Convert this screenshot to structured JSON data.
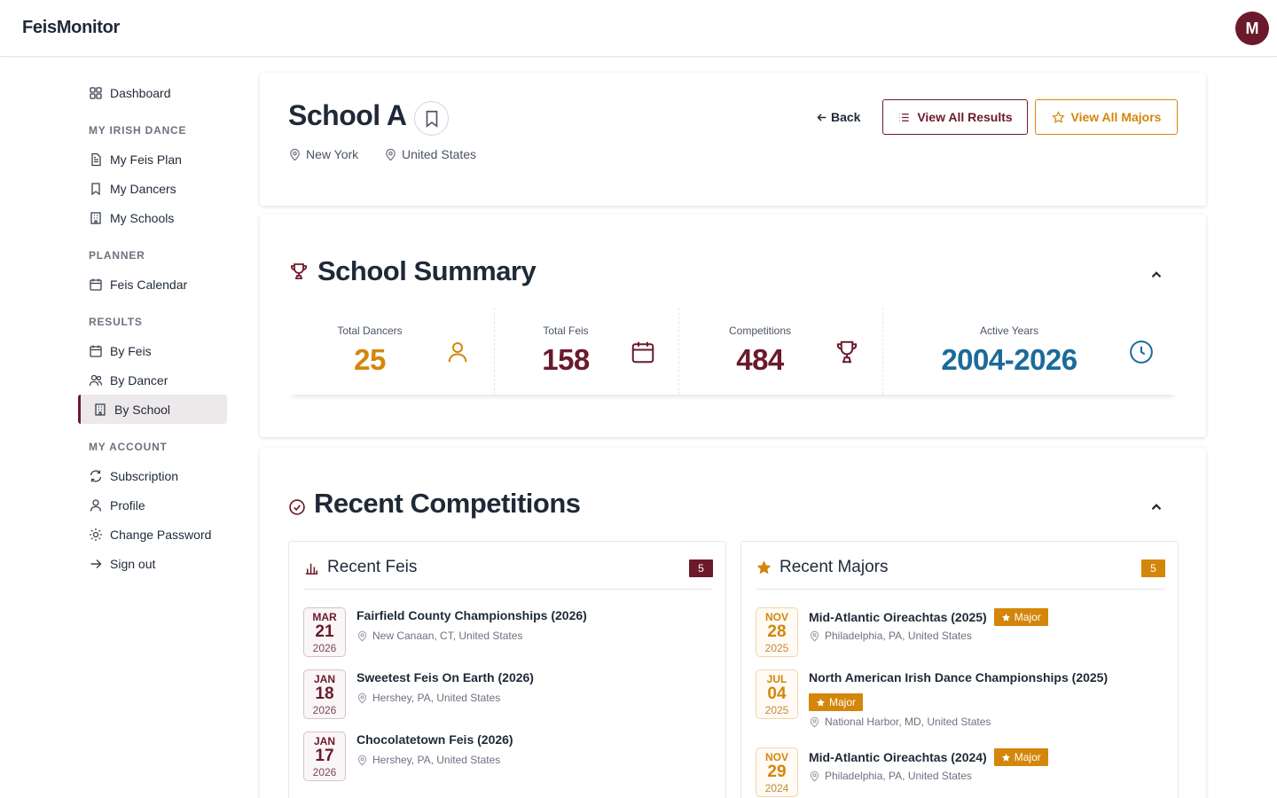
{
  "app": {
    "brand": "FeisMonitor",
    "avatar_initial": "M"
  },
  "sidebar": {
    "dashboard": "Dashboard",
    "sections": [
      {
        "heading": "MY IRISH DANCE",
        "items": [
          "My Feis Plan",
          "My Dancers",
          "My Schools"
        ]
      },
      {
        "heading": "PLANNER",
        "items": [
          "Feis Calendar"
        ]
      },
      {
        "heading": "RESULTS",
        "items": [
          "By Feis",
          "By Dancer",
          "By School"
        ]
      },
      {
        "heading": "MY ACCOUNT",
        "items": [
          "Subscription",
          "Profile",
          "Change Password",
          "Sign out"
        ]
      }
    ],
    "active": "By School"
  },
  "school": {
    "name": "School A",
    "city": "New York",
    "country": "United States",
    "back_label": "Back",
    "view_results_label": "View All Results",
    "view_majors_label": "View All Majors"
  },
  "summary": {
    "title": "School Summary",
    "stats": [
      {
        "label": "Total Dancers",
        "value": "25",
        "icon": "user-icon",
        "color": "#d4860b"
      },
      {
        "label": "Total Feis",
        "value": "158",
        "icon": "calendar-icon",
        "color": "#6b1a2b"
      },
      {
        "label": "Competitions",
        "value": "484",
        "icon": "trophy-icon",
        "color": "#6b1a2b"
      },
      {
        "label": "Active Years",
        "value": "2004-2026",
        "icon": "clock-icon",
        "color": "#1a6b9a"
      }
    ]
  },
  "recent": {
    "title": "Recent Competitions",
    "feis_panel": {
      "title": "Recent Feis",
      "count": "5",
      "items": [
        {
          "mon": "MAR",
          "day": "21",
          "year": "2026",
          "name": "Fairfield County Championships (2026)",
          "location": "New Canaan, CT, United States"
        },
        {
          "mon": "JAN",
          "day": "18",
          "year": "2026",
          "name": "Sweetest Feis On Earth (2026)",
          "location": "Hershey, PA, United States"
        },
        {
          "mon": "JAN",
          "day": "17",
          "year": "2026",
          "name": "Chocolatetown Feis (2026)",
          "location": "Hershey, PA, United States"
        }
      ]
    },
    "majors_panel": {
      "title": "Recent Majors",
      "count": "5",
      "major_label": "Major",
      "items": [
        {
          "mon": "NOV",
          "day": "28",
          "year": "2025",
          "name": "Mid-Atlantic Oireachtas (2025)",
          "location": "Philadelphia, PA, United States"
        },
        {
          "mon": "JUL",
          "day": "04",
          "year": "2025",
          "name": "North American Irish Dance Championships (2025)",
          "location": "National Harbor, MD, United States"
        },
        {
          "mon": "NOV",
          "day": "29",
          "year": "2024",
          "name": "Mid-Atlantic Oireachtas (2024)",
          "location": "Philadelphia, PA, United States"
        }
      ]
    }
  },
  "colors": {
    "maroon": "#6b1a2b",
    "orange": "#d4860b",
    "blue": "#1a6b9a"
  }
}
